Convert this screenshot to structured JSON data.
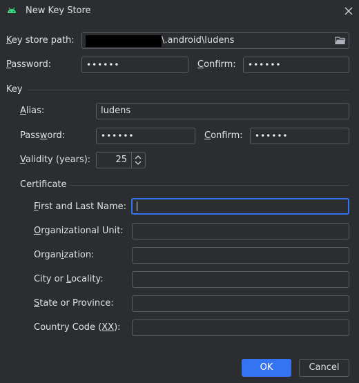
{
  "window": {
    "title": "New Key Store"
  },
  "keystore": {
    "path_label_pre": "",
    "path_label_key": "K",
    "path_label_post": "ey store path:",
    "path_value": "\\.android\\ludens",
    "password_label_key": "P",
    "password_label_post": "assword:",
    "password_value": "••••••",
    "confirm_label_key": "C",
    "confirm_label_post": "onfirm:",
    "confirm_value": "••••••"
  },
  "key": {
    "section_title": "Key",
    "alias_label_key": "A",
    "alias_label_post": "lias:",
    "alias_value": "ludens",
    "password_label_pre": "Pass",
    "password_label_key": "w",
    "password_label_post": "ord:",
    "password_value": "••••••",
    "confirm_label_key": "C",
    "confirm_label_post": "onfirm:",
    "confirm_value": "••••••",
    "validity_label_key": "V",
    "validity_label_post": "alidity (years):",
    "validity_value": "25"
  },
  "certificate": {
    "section_title": "Certificate",
    "fields": [
      {
        "pre": "",
        "key": "F",
        "post": "irst and Last Name:",
        "value": ""
      },
      {
        "pre": "",
        "key": "O",
        "post": "rganizational Unit:",
        "value": ""
      },
      {
        "pre": "Organ",
        "key": "i",
        "post": "zation:",
        "value": ""
      },
      {
        "pre": "City or ",
        "key": "L",
        "post": "ocality:",
        "value": ""
      },
      {
        "pre": "",
        "key": "S",
        "post": "tate or Province:",
        "value": ""
      },
      {
        "pre": "Country Code (",
        "key": "XX",
        "post": "):",
        "value": ""
      }
    ]
  },
  "buttons": {
    "ok_label": "OK",
    "cancel_label": "Cancel"
  },
  "colors": {
    "accent": "#3574f0",
    "background": "#2b2d30",
    "border": "#5a5d63",
    "android_green": "#3ddc84"
  },
  "icons": {
    "app": "android-icon",
    "close": "close-icon",
    "browse": "folder-icon",
    "spinner": "spinner-arrows-icon"
  }
}
